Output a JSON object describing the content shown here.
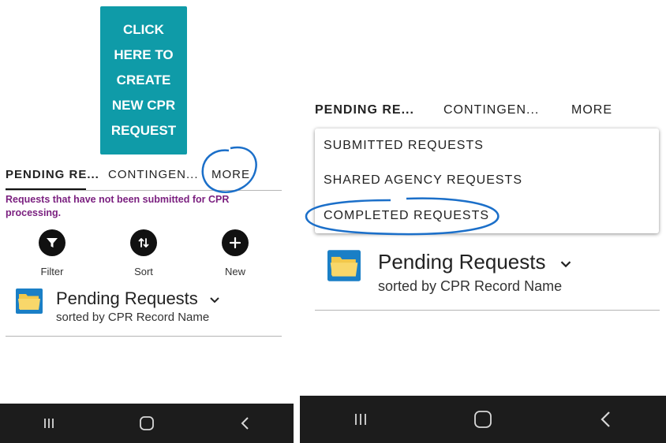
{
  "left": {
    "create_button": "CLICK\nHERE TO\nCREATE\nNEW CPR\nREQUEST",
    "tabs": [
      "PENDING RE...",
      "CONTINGEN...",
      "MORE"
    ],
    "description": "Requests that have not been submitted for CPR processing.",
    "actions": [
      {
        "label": "Filter",
        "icon": "filter-icon"
      },
      {
        "label": "Sort",
        "icon": "sort-icon"
      },
      {
        "label": "New",
        "icon": "plus-icon"
      }
    ],
    "list": {
      "title": "Pending Requests",
      "subtitle": "sorted by CPR Record Name",
      "icon": "folder-icon"
    }
  },
  "right": {
    "tabs": [
      "PENDING RE...",
      "CONTINGEN...",
      "MORE"
    ],
    "dropdown": [
      "SUBMITTED REQUESTS",
      "SHARED AGENCY REQUESTS",
      "COMPLETED REQUESTS"
    ],
    "list": {
      "title": "Pending Requests",
      "subtitle": "sorted by CPR Record Name",
      "icon": "folder-icon"
    }
  },
  "nav": [
    "recents-icon",
    "home-icon",
    "back-icon"
  ],
  "colors": {
    "accent": "#0f9ba8",
    "description_text": "#7a1f7f",
    "annotation": "#1b6fc9",
    "navbar": "#1c1c1c"
  }
}
